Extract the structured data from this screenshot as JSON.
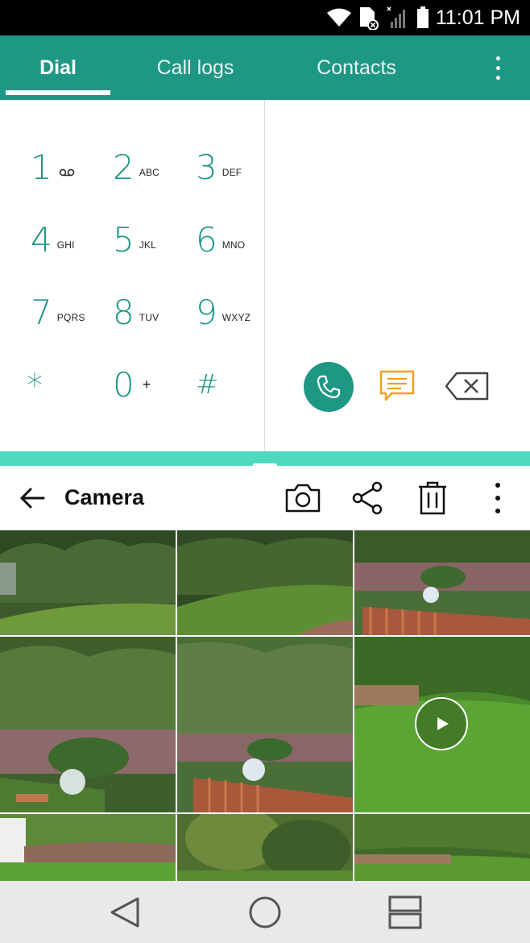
{
  "status_bar": {
    "time": "11:01 PM",
    "icons": [
      "wifi-icon",
      "sim-error-icon",
      "signal-icon",
      "battery-icon"
    ]
  },
  "dialer": {
    "tabs": [
      {
        "label": "Dial",
        "active": true
      },
      {
        "label": "Call logs",
        "active": false
      },
      {
        "label": "Contacts",
        "active": false
      }
    ],
    "keys": [
      {
        "digit": "1",
        "letters": "",
        "icon": "voicemail-icon"
      },
      {
        "digit": "2",
        "letters": "ABC"
      },
      {
        "digit": "3",
        "letters": "DEF"
      },
      {
        "digit": "4",
        "letters": "GHI"
      },
      {
        "digit": "5",
        "letters": "JKL"
      },
      {
        "digit": "6",
        "letters": "MNO"
      },
      {
        "digit": "7",
        "letters": "PQRS"
      },
      {
        "digit": "8",
        "letters": "TUV"
      },
      {
        "digit": "9",
        "letters": "WXYZ"
      },
      {
        "digit": "*",
        "letters": ""
      },
      {
        "digit": "0",
        "letters": "+"
      },
      {
        "digit": "#",
        "letters": ""
      }
    ],
    "actions": [
      "call-icon",
      "message-icon",
      "backspace-icon"
    ]
  },
  "gallery": {
    "title": "Camera",
    "toolbar_icons": [
      "camera-icon",
      "share-icon",
      "trash-icon",
      "more-icon"
    ],
    "photos": [
      {
        "type": "photo"
      },
      {
        "type": "photo"
      },
      {
        "type": "photo"
      },
      {
        "type": "photo"
      },
      {
        "type": "photo"
      },
      {
        "type": "video"
      },
      {
        "type": "photo"
      },
      {
        "type": "photo"
      },
      {
        "type": "photo"
      }
    ]
  },
  "colors": {
    "accent": "#1f9785",
    "split_handle": "#4fd9c1",
    "message_icon": "#f0a020"
  },
  "nav_bar": [
    "back-icon",
    "home-icon",
    "recents-icon"
  ]
}
